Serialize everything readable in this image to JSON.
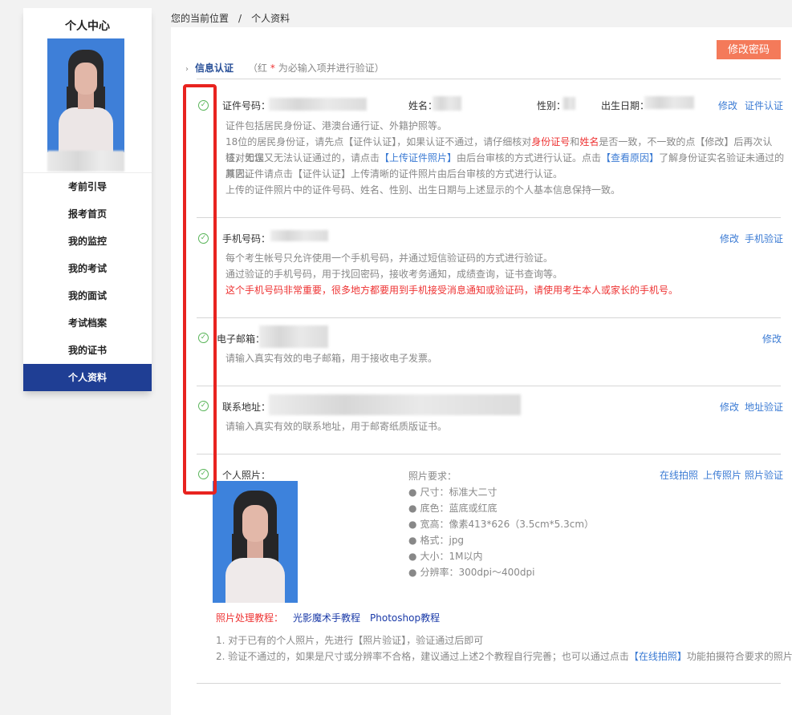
{
  "sidebar": {
    "title": "个人中心",
    "items": [
      {
        "label": "考前引导",
        "active": false
      },
      {
        "label": "报考首页",
        "active": false
      },
      {
        "label": "我的监控",
        "active": false
      },
      {
        "label": "我的考试",
        "active": false
      },
      {
        "label": "我的面试",
        "active": false
      },
      {
        "label": "考试档案",
        "active": false
      },
      {
        "label": "我的证书",
        "active": false
      },
      {
        "label": "个人资料",
        "active": true
      }
    ]
  },
  "breadcrumb": {
    "prefix": "您的当前位置",
    "separator": "/",
    "current": "个人资料"
  },
  "actions": {
    "change_password": "修改密码"
  },
  "section": {
    "title": "信息认证",
    "note_prefix": "（红",
    "note_star": "*",
    "note_suffix": "为必输入项并进行验证）"
  },
  "id_card": {
    "label": "证件号码：",
    "name_label": "姓名：",
    "gender_label": "性别：",
    "birth_label": "出生日期：",
    "edit": "修改",
    "verify": "证件认证",
    "notes": {
      "n1": "证件包括居民身份证、港澳台通行证、外籍护照等。",
      "n2a": "18位的居民身份证，请先点【证件认证】，如果认证不通过，请仔细核对",
      "n2b": "身份证号",
      "n2c": "和",
      "n2d": "姓名",
      "n2e": "是否一致，不一致的点【修改】后再次认证，如您",
      "n2f": "核对无误又无法认证通过的，请点击",
      "n2g": "【上传证件照片】",
      "n2h": "由后台审核的方式进行认证。点击",
      "n2i": "【查看原因】",
      "n2j": "了解身份证实名验证未通过的原因。",
      "n3": "其它证件请点击【证件认证】上传清晰的证件照片由后台审核的方式进行认证。",
      "n4": "上传的证件照片中的证件号码、姓名、性别、出生日期与上述显示的个人基本信息保持一致。"
    }
  },
  "phone": {
    "label": "手机号码：",
    "edit": "修改",
    "verify": "手机验证",
    "notes": {
      "n1": "每个考生帐号只允许使用一个手机号码，并通过短信验证码的方式进行验证。",
      "n2": "通过验证的手机号码，用于找回密码，接收考务通知，成绩查询，证书查询等。",
      "n3": "这个手机号码非常重要，很多地方都要用到手机接受消息通知或验证码，请使用考生本人或家长的手机号。"
    }
  },
  "email": {
    "label": "电子邮箱：",
    "edit": "修改",
    "notes": {
      "n1": "请输入真实有效的电子邮箱，用于接收电子发票。"
    }
  },
  "address": {
    "label": "联系地址：",
    "edit": "修改",
    "verify": "地址验证",
    "notes": {
      "n1": "请输入真实有效的联系地址，用于邮寄纸质版证书。"
    }
  },
  "photo": {
    "label": "个人照片：",
    "online_shoot": "在线拍照",
    "upload": "上传照片",
    "verify": "照片验证",
    "req_title": "照片要求：",
    "requirements": [
      "尺寸：标准大二寸",
      "底色：蓝底或红底",
      "宽高：像素413*626（3.5cm*5.3cm）",
      "格式：jpg",
      "大小：1M以内",
      "分辨率：300dpi～400dpi"
    ],
    "tutorial_label": "照片处理教程：",
    "tutorial_1": "光影魔术手教程",
    "tutorial_2": "Photoshop教程",
    "tips": {
      "t1": "1. 对于已有的个人照片，先进行【照片验证】，验证通过后即可",
      "t2a": "2. 验证不通过的，如果是尺寸或分辨率不合格，建议通过上述2个教程自行完善；也可以通过点击",
      "t2b": "【在线拍照】",
      "t2c": "功能拍摄符合要求的照片。"
    }
  },
  "bullet": "●",
  "check_glyph": "✓",
  "arrow_glyph": "›",
  "colors": {
    "nav_active": "#1f3e94",
    "accent_link": "#3b7bd4",
    "button": "#f47a5a",
    "warning": "#e33",
    "verified": "#5ab55a"
  }
}
